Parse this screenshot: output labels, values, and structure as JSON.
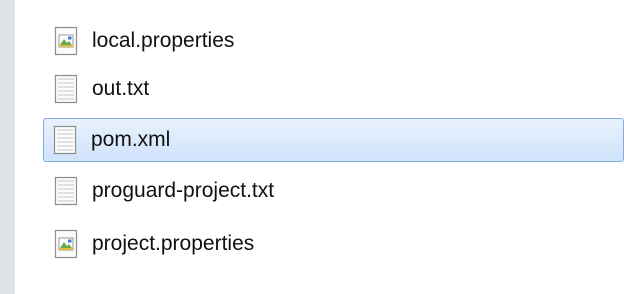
{
  "files": [
    {
      "name": "local.properties",
      "icon": "properties-file-icon",
      "selected": false
    },
    {
      "name": "out.txt",
      "icon": "text-file-icon",
      "selected": false
    },
    {
      "name": "pom.xml",
      "icon": "text-file-icon",
      "selected": true
    },
    {
      "name": "proguard-project.txt",
      "icon": "text-file-icon",
      "selected": false
    },
    {
      "name": "project.properties",
      "icon": "properties-file-icon",
      "selected": false
    }
  ],
  "colors": {
    "background": "#dfe3e8",
    "pane": "#ffffff",
    "selection_border": "#84acdd",
    "selection_fill": "#cfe3fb"
  }
}
